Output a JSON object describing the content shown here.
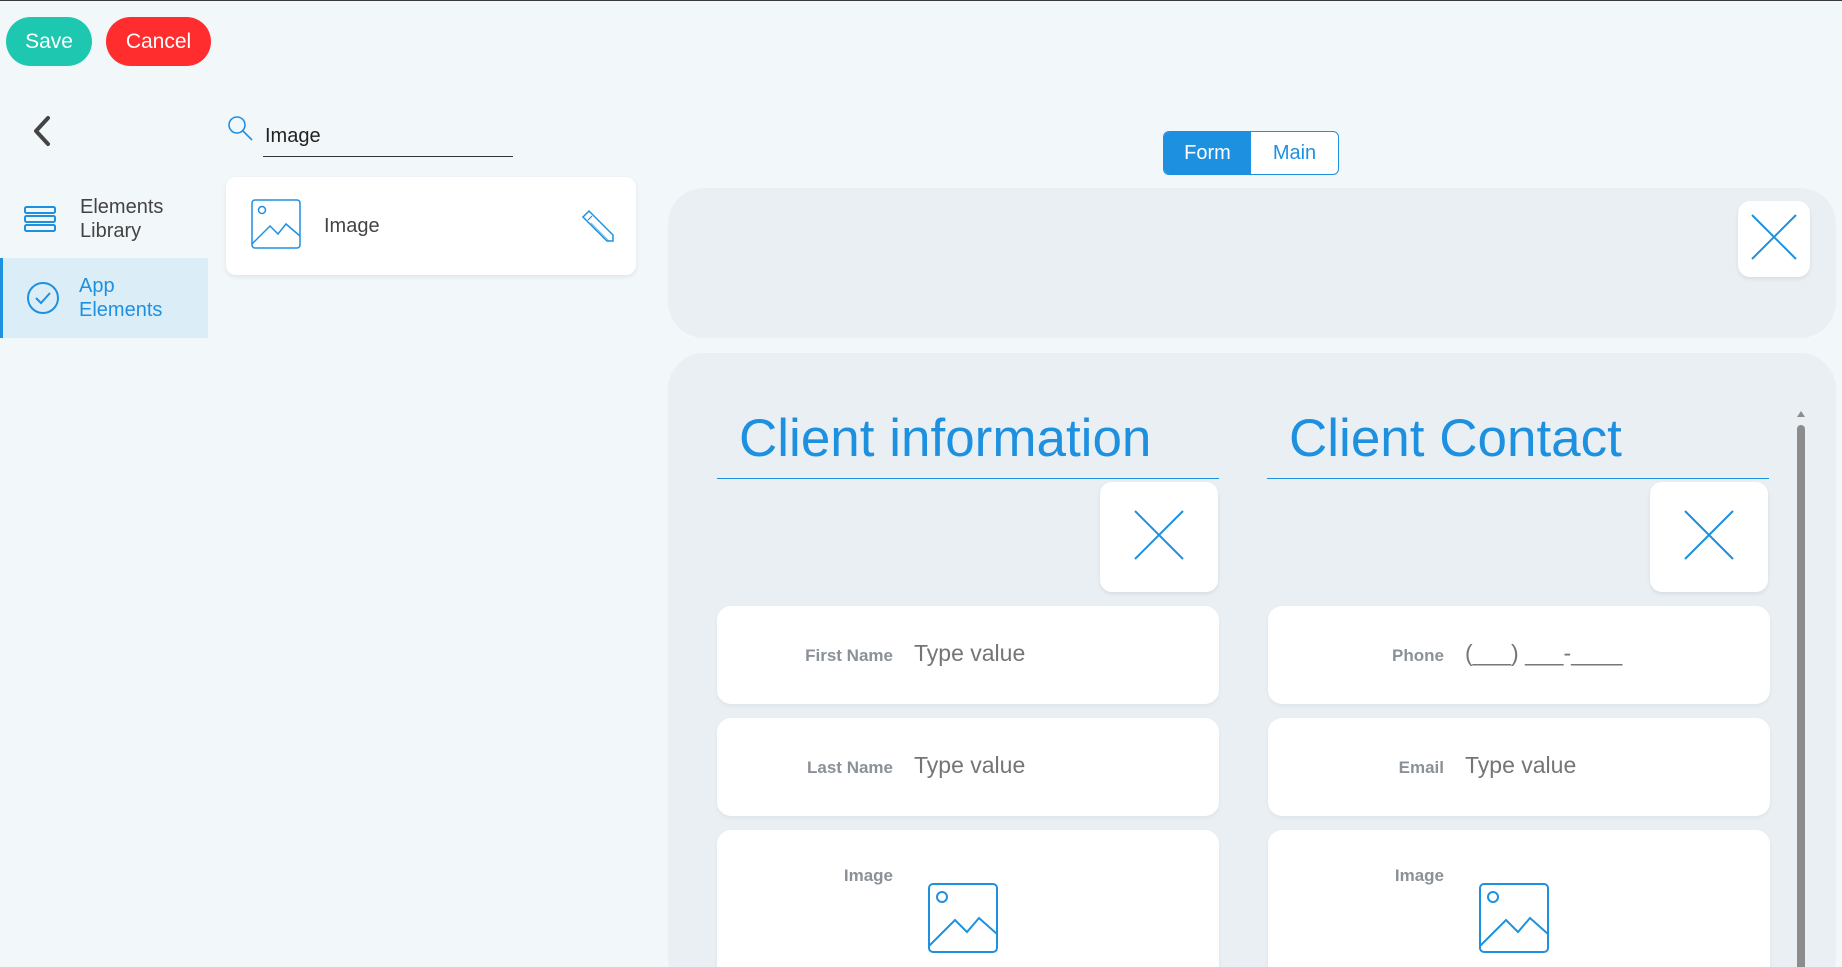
{
  "toolbar": {
    "save_label": "Save",
    "cancel_label": "Cancel"
  },
  "sidebar": {
    "items": [
      {
        "label_line1": "Elements",
        "label_line2": "Library",
        "icon": "stack-icon",
        "active": false
      },
      {
        "label_line1": "App",
        "label_line2": "Elements",
        "icon": "check-circle-icon",
        "active": true
      }
    ]
  },
  "search": {
    "value": "Image",
    "placeholder": ""
  },
  "results": [
    {
      "label": "Image",
      "icon": "image-icon",
      "action_icon": "pencil-icon"
    }
  ],
  "view_toggle": {
    "options": [
      "Form",
      "Main"
    ],
    "selected": "Form"
  },
  "form": {
    "columns": [
      {
        "title": "Client information",
        "fields": [
          {
            "label": "First Name",
            "placeholder": "Type value",
            "type": "text"
          },
          {
            "label": "Last Name",
            "placeholder": "Type value",
            "type": "text"
          },
          {
            "label": "Image",
            "type": "image"
          }
        ]
      },
      {
        "title": "Client Contact",
        "fields": [
          {
            "label": "Phone",
            "placeholder": "(___) ___-____",
            "type": "phone"
          },
          {
            "label": "Email",
            "placeholder": "Type value",
            "type": "text"
          },
          {
            "label": "Image",
            "type": "image"
          }
        ]
      }
    ]
  },
  "colors": {
    "accent": "#1e90e0",
    "save": "#1ec8b0",
    "cancel": "#ff2d2d",
    "background": "#f2f7fa",
    "panel": "#e9eff3"
  }
}
